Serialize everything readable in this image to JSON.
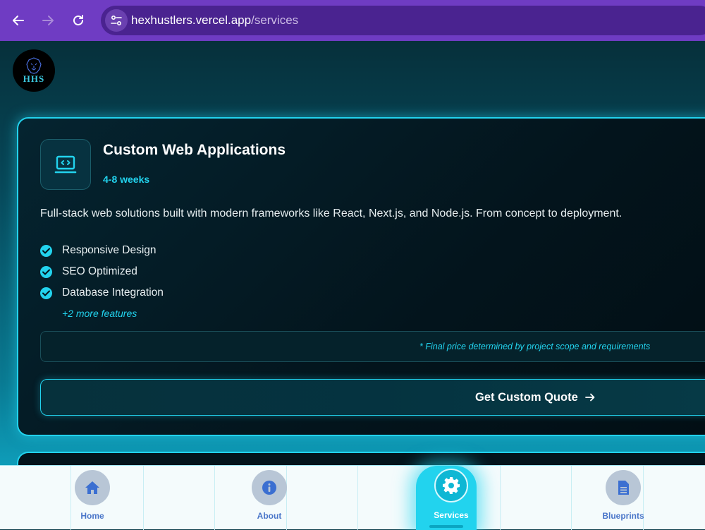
{
  "browser": {
    "url_host": "hexhustlers.vercel.app",
    "url_path": "/services"
  },
  "logo": {
    "text": "HHS"
  },
  "service_card": {
    "title": "Custom Web Applications",
    "duration": "4-8 weeks",
    "description": "Full-stack web solutions built with modern frameworks like React, Next.js, and Node.js. From concept to deployment.",
    "features": [
      "Responsive Design",
      "SEO Optimized",
      "Database Integration"
    ],
    "more_features": "+2 more features",
    "price_note": "* Final price determined by project scope and requirements",
    "cta_label": "Get Custom Quote"
  },
  "bottom_nav": {
    "items": [
      {
        "label": "Home",
        "icon": "home-icon"
      },
      {
        "label": "About",
        "icon": "info-icon"
      },
      {
        "label": "Services",
        "icon": "gear-icon",
        "active": true
      },
      {
        "label": "Blueprints",
        "icon": "document-icon"
      }
    ]
  },
  "colors": {
    "browser_chrome": "#6f3cc3",
    "accent": "#22d3ee",
    "card_bg": "#03141c",
    "nav_label": "#4a76c9"
  }
}
